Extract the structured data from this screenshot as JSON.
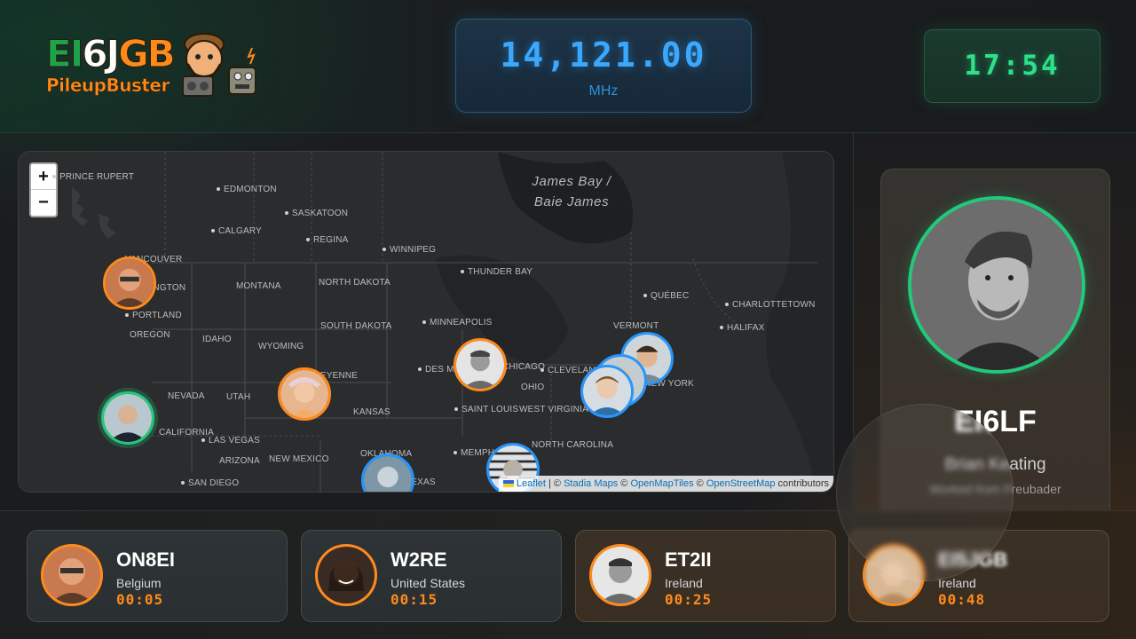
{
  "logo": {
    "callsign_part1": "EI",
    "callsign_part2": "6J",
    "callsign_part3": "GB",
    "subtitle": "PileupBuster",
    "mascot_icon": "bearded-operator-mascot"
  },
  "frequency": {
    "value": "14,121.00",
    "unit": "MHz",
    "color": "#3aa8ff"
  },
  "clock": {
    "time": "17:54",
    "color": "#2de08a"
  },
  "map": {
    "zoom_in": "+",
    "zoom_out": "−",
    "water_labels": {
      "james_bay": "James Bay /\nBaie James"
    },
    "labels": {
      "prince_rupert": "PRINCE RUPERT",
      "edmonton": "EDMONTON",
      "saskatoon": "SASKATOON",
      "calgary": "CALGARY",
      "regina": "REGINA",
      "winnipeg": "WINNIPEG",
      "vancouver": "VANCOUVER",
      "washington": "WASHINGTON",
      "montana": "MONTANA",
      "north_dakota": "NORTH DAKOTA",
      "thunder_bay": "THUNDER BAY",
      "quebec": "QUÉBEC",
      "charlottetown": "CHARLOTTETOWN",
      "halifax": "HALIFAX",
      "vermont": "VERMONT",
      "portland": "PORTLAND",
      "oregon": "OREGON",
      "idaho": "IDAHO",
      "wyoming": "WYOMING",
      "south_dakota": "SOUTH DAKOTA",
      "minneapolis": "MINNEAPOLIS",
      "des_moines": "DES MOINES",
      "chicago": "CHICAGO",
      "cleveland": "CLEVELAND",
      "new_york": "NEW YORK",
      "ohio": "OHIO",
      "nevada": "NEVADA",
      "utah": "UTAH",
      "cheyenne": "CHEYENNE",
      "kansas": "KANSAS",
      "saint_louis": "SAINT LOUIS",
      "west_virginia": "WEST VIRGINIA",
      "california": "CALIFORNIA",
      "las_vegas": "LAS VEGAS",
      "arizona": "ARIZONA",
      "new_mexico": "NEW MEXICO",
      "oklahoma": "OKLAHOMA",
      "texas": "TEXAS",
      "memphis": "MEMPHIS",
      "north_carolina": "NORTH CAROLINA",
      "san_diego": "SAN DIEGO"
    },
    "attribution": {
      "leaflet": "Leaflet",
      "sep1": " | © ",
      "stadia": "Stadia Maps",
      "sep2": " © ",
      "omt": "OpenMapTiles",
      "sep3": " © ",
      "osm": "OpenStreetMap",
      "suffix": " contributors"
    },
    "markers_colors": {
      "queued": "#ff8a1c",
      "worked": "#2596ff",
      "active": "#22c97a"
    }
  },
  "active_station": {
    "callsign": "EI6LF",
    "name": "Brian Keating",
    "worked_from": "Worked from Freubader",
    "ring_color": "#22c97a"
  },
  "queue": [
    {
      "callsign": "ON8EI",
      "country": "Belgium",
      "wait": "00:05"
    },
    {
      "callsign": "W2RE",
      "country": "United States",
      "wait": "00:15"
    },
    {
      "callsign": "ET2II",
      "country": "Ireland",
      "wait": "00:25"
    },
    {
      "callsign": "EI5JGB",
      "country": "Ireland",
      "wait": "00:48"
    }
  ]
}
